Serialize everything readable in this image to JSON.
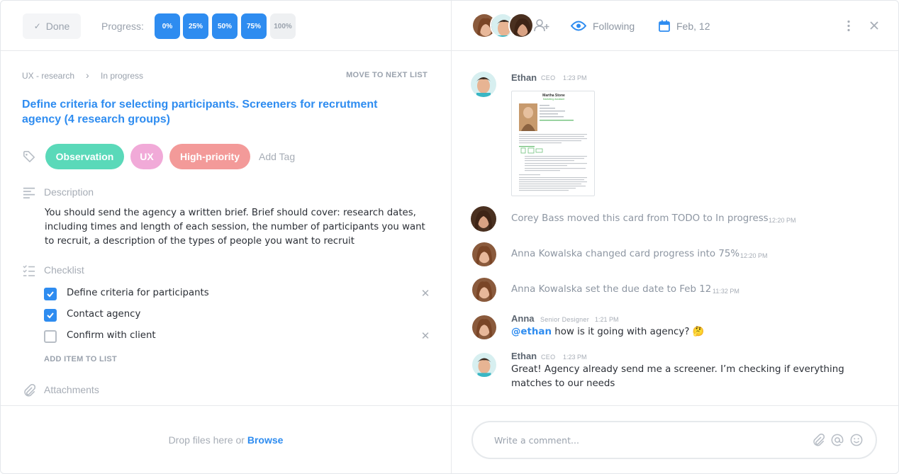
{
  "toolbar": {
    "done_label": "Done",
    "progress_label": "Progress:",
    "progress_options": [
      "0%",
      "25%",
      "50%",
      "75%",
      "100%"
    ],
    "progress_value": 0.75
  },
  "breadcrumb": {
    "list": "UX - research",
    "status": "In progress",
    "move_next": "MOVE TO NEXT LIST"
  },
  "task": {
    "title": "Define criteria for selecting participants. Screeners for recrutment agency (4 research groups)"
  },
  "tags": {
    "items": [
      {
        "label": "Observation",
        "color": "#5ad9b9"
      },
      {
        "label": "UX",
        "color": "#f1aad8"
      },
      {
        "label": "High-priority",
        "color": "#f39a99"
      }
    ],
    "add_label": "Add Tag"
  },
  "description": {
    "label": "Description",
    "text": "You should send the agency a written brief. Brief should cover:  research dates, including times and length of each session, the number of participants you want to recruit, a description of the types of people you want to recruit"
  },
  "checklist": {
    "label": "Checklist",
    "items": [
      {
        "label": "Define criteria for participants",
        "checked": true
      },
      {
        "label": "Contact agency",
        "checked": true
      },
      {
        "label": "Confirm with client",
        "checked": false
      }
    ],
    "add_label": "ADD ITEM TO LIST"
  },
  "attachments": {
    "label": "Attachments",
    "drop_text": "Drop files here or ",
    "browse_label": "Browse"
  },
  "header": {
    "following_label": "Following",
    "due_date": "Feb, 12"
  },
  "feed": {
    "doc": {
      "name": "Martha Stone",
      "subtitle": "Marketing Assistant"
    },
    "items": [
      {
        "author": "Ethan",
        "role": "CEO",
        "time": "1:23 PM"
      },
      {
        "text": "Corey Bass moved this card from TODO to In progress",
        "time": "12:20 PM"
      },
      {
        "text": "Anna Kowalska changed card progress into 75%",
        "time": "12:20 PM"
      },
      {
        "text": "Anna Kowalska set the due date to Feb 12",
        "time": "11:32 PM"
      },
      {
        "author": "Anna",
        "role": "Senior Designer",
        "time": "1:21 PM",
        "mention": "@ethan",
        "text": " how is it going with agency? 🤔"
      },
      {
        "author": "Ethan",
        "role": "CEO",
        "time": "1:23 PM",
        "text": "Great! Agency already send me a screener. I’m checking if everything matches to our needs"
      }
    ]
  },
  "comment": {
    "placeholder": "Write a comment..."
  },
  "colors": {
    "accent": "#2e8cf0",
    "muted": "#9aa2ad"
  }
}
